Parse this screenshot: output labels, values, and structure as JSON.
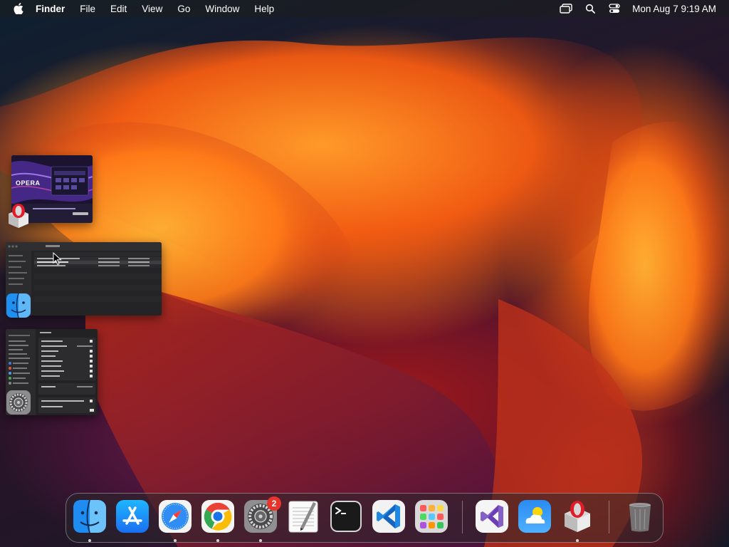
{
  "menubar": {
    "apple_icon": "apple-logo-icon",
    "app_name": "Finder",
    "menus": [
      "File",
      "Edit",
      "View",
      "Go",
      "Window",
      "Help"
    ],
    "status_icons": [
      "screen-mirroring-icon",
      "spotlight-search-icon",
      "control-center-icon"
    ],
    "clock": "Mon Aug 7  9:19 AM"
  },
  "stage_manager": {
    "opera_thumb": {
      "app": "Opera Installer",
      "text": "OPERA",
      "icon": "opera-installer-icon"
    },
    "finder_thumb": {
      "app": "Finder",
      "icon": "finder-icon"
    },
    "settings_thumb": {
      "app": "System Settings",
      "icon": "system-settings-icon"
    }
  },
  "dock": {
    "items": [
      {
        "name": "Finder",
        "icon": "finder-icon",
        "running": true
      },
      {
        "name": "App Store",
        "icon": "app-store-icon",
        "running": false
      },
      {
        "name": "Safari",
        "icon": "safari-icon",
        "running": true
      },
      {
        "name": "Google Chrome",
        "icon": "chrome-icon",
        "running": true
      },
      {
        "name": "System Settings",
        "icon": "system-settings-icon",
        "running": true,
        "badge": "2"
      },
      {
        "name": "TextEdit",
        "icon": "textedit-icon",
        "running": false
      },
      {
        "name": "Terminal",
        "icon": "terminal-icon",
        "running": false
      },
      {
        "name": "Visual Studio Code",
        "icon": "vscode-icon",
        "running": false
      },
      {
        "name": "Launchpad",
        "icon": "launchpad-icon",
        "running": false
      },
      {
        "name": "Visual Studio",
        "icon": "visual-studio-icon",
        "running": false
      },
      {
        "name": "Weather",
        "icon": "weather-icon",
        "running": false
      },
      {
        "name": "Opera Installer",
        "icon": "opera-installer-icon",
        "running": true
      },
      {
        "name": "Trash",
        "icon": "trash-icon",
        "running": false
      }
    ]
  },
  "colors": {
    "menubar_bg": "#1e1e1e",
    "badge": "#e8352b",
    "wallpaper_orange": "#ff8a1e",
    "wallpaper_red": "#a0181a"
  }
}
